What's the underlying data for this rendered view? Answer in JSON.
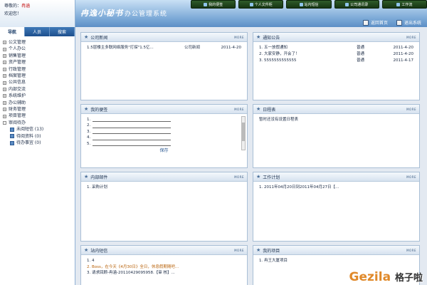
{
  "welcome": {
    "line1": "尊敬的：",
    "user": "冉涵",
    "line2": "欢迎您！"
  },
  "app": {
    "logo": "冉逸小秘书",
    "subtitle": "办公管理系统"
  },
  "top_buttons": [
    "我的便签",
    "个人文件柜",
    "站内短信",
    "公司通讯录",
    "工作流"
  ],
  "top_links": [
    "返回首页",
    "退出系统"
  ],
  "sidebar": {
    "tabs": [
      "导航",
      "人员",
      "搜索"
    ],
    "items": [
      "公文管理",
      "个人办公",
      "销售管理",
      "资产管理",
      "行政管理",
      "档案管理",
      "公共信息",
      "内部交流",
      "系统维护",
      "办公辅助",
      "财务管理",
      "项目管理",
      "审阅待办"
    ],
    "children": [
      "未阅短信 (13)",
      "待阅资料 (0)",
      "待办事宜 (0)"
    ]
  },
  "panels": {
    "news": {
      "title": "公司新闻",
      "more": "MORE",
      "rows": [
        {
          "t": "1.5层楼主多联网络服务\"打探\"1.5亿...",
          "a": "公司新闻",
          "d": "2011-4-20"
        }
      ]
    },
    "notice": {
      "title": "通知公告",
      "more": "MORE",
      "rows": [
        {
          "t": "1. 五一放假通知",
          "a": "普通",
          "d": "2011-4-20"
        },
        {
          "t": "2. 大家安静，开会了！",
          "a": "普通",
          "d": "2011-4-20"
        },
        {
          "t": "3. 5555555555555",
          "a": "普通",
          "d": "2011-4-17"
        }
      ]
    },
    "memo": {
      "title": "我的便签",
      "more": "MORE",
      "lines": [
        "1.",
        "2.",
        "3.",
        "4.",
        "5."
      ],
      "save": "保存"
    },
    "schedule": {
      "title": "日程表",
      "more": "MORE",
      "text": "暂时还没有设置日程表"
    },
    "mail": {
      "title": "内部邮件",
      "more": "MORE",
      "text": "1. 采购计划"
    },
    "plan": {
      "title": "工作计划",
      "more": "MORE",
      "text": "1. 2011年04月20日到2011年04月27日【..."
    },
    "sms": {
      "title": "站内短信",
      "more": "MORE",
      "lines": [
        "1. 4",
        "2. Boss，在今天《4月30日》全日，休息假期随吧...",
        "3. 请求回顾-冉涵-20110429095958.【审 核】..."
      ]
    },
    "project": {
      "title": "我的项目",
      "more": "MORE",
      "text": "1. 冉王大厦项目"
    }
  },
  "watermark": {
    "latin": "Gezila",
    "cn": "格子啦"
  }
}
